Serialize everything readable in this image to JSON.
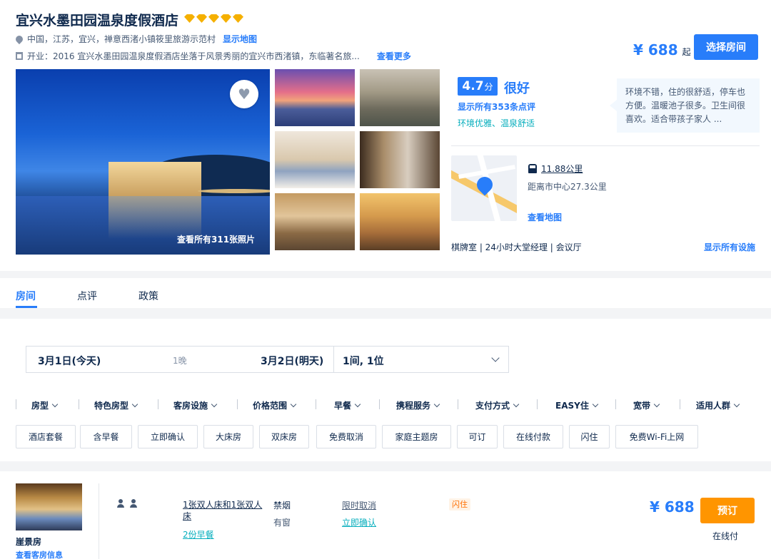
{
  "hotel": {
    "name": "宜兴水墨田园温泉度假酒店",
    "star_count": 5,
    "location": "中国，江苏，宜兴，禅意西渚小镇筱里旅游示范村",
    "show_map": "显示地图",
    "intro": "开业：2016  宜兴水墨田园温泉度假酒店坐落于风景秀丽的宜兴市西渚镇，东临著名旅...",
    "see_more": "查看更多",
    "price": "¥ 688",
    "price_suffix": "起",
    "select_room": "选择房间",
    "all_photos": "查看所有311张照片"
  },
  "rating": {
    "score": "4.7",
    "score_unit": "分",
    "label": "很好",
    "reviews_link": "显示所有353条点评",
    "tags": "环境优雅、温泉舒适",
    "quote": "环境不错，住的很舒适，停车也方便。温暖池子很多。卫生间很喜欢。适合带孩子家人 ..."
  },
  "location": {
    "station_distance": "11.88公里",
    "center_distance": "距离市中心27.3公里",
    "view_map": "查看地图",
    "facilities": "棋牌室 | 24小时大堂经理 | 会议厅",
    "all_facilities": "显示所有设施"
  },
  "tabs": [
    {
      "label": "房间"
    },
    {
      "label": "点评"
    },
    {
      "label": "政策"
    }
  ],
  "search": {
    "checkin": "3月1日(今天)",
    "nights": "1晚",
    "checkout": "3月2日(明天)",
    "guests": "1间, 1位"
  },
  "filter_categories": [
    "房型",
    "特色房型",
    "客房设施",
    "价格范围",
    "早餐",
    "携程服务",
    "支付方式",
    "EASY住",
    "宽带",
    "适用人群"
  ],
  "filter_chips": [
    "酒店套餐",
    "含早餐",
    "立即确认",
    "大床房",
    "双床房",
    "免费取消",
    "家庭主题房",
    "可订",
    "在线付款",
    "闪住",
    "免费Wi-Fi上网"
  ],
  "room": {
    "name": "崖景房",
    "info_link": "查看客房信息",
    "bed": "1张双人床和1张双人床",
    "breakfast": "2份早餐",
    "smoking": "禁烟",
    "window": "有窗",
    "cancel": "限时取消",
    "confirm": "立即确认",
    "badge": "闪住",
    "price": "¥ 688",
    "book": "预订",
    "payment": "在线付"
  },
  "colors": {
    "accent": "#287dfa",
    "book_orange": "#ff9500",
    "teal": "#06aebd",
    "star_gold": "#f5b000"
  }
}
